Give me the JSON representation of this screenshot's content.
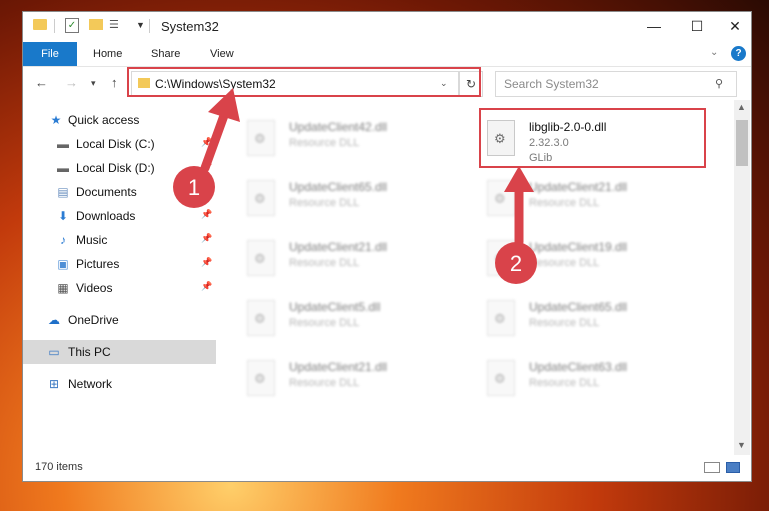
{
  "window": {
    "title": "System32",
    "controls": {
      "minimize": "—",
      "maximize": "☐",
      "close": "✕"
    }
  },
  "ribbon": {
    "tabs": [
      "File",
      "Home",
      "Share",
      "View"
    ],
    "help": "?",
    "expand": "⌄"
  },
  "navigation": {
    "back": "←",
    "forward": "→",
    "recent": "▾",
    "up": "↑",
    "address": "C:\\Windows\\System32",
    "refresh": "↻",
    "search_placeholder": "Search System32",
    "search_icon": "⚲"
  },
  "sidebar": {
    "items": [
      {
        "label": "Quick access",
        "icon": "star-icon"
      },
      {
        "label": "Local Disk (C:)",
        "icon": "drive-icon"
      },
      {
        "label": "Local Disk (D:)",
        "icon": "drive-icon"
      },
      {
        "label": "Documents",
        "icon": "documents-icon"
      },
      {
        "label": "Downloads",
        "icon": "download-icon"
      },
      {
        "label": "Music",
        "icon": "music-icon"
      },
      {
        "label": "Pictures",
        "icon": "pictures-icon"
      },
      {
        "label": "Videos",
        "icon": "videos-icon"
      },
      {
        "label": "OneDrive",
        "icon": "cloud-icon"
      },
      {
        "label": "This PC",
        "icon": "computer-icon"
      },
      {
        "label": "Network",
        "icon": "network-icon"
      }
    ]
  },
  "files": [
    {
      "name": "UpdateClient42.dll",
      "type": "Resource DLL"
    },
    {
      "name": "libglib-2.0-0.dll",
      "version": "2.32.3.0",
      "company": "GLib"
    },
    {
      "name": "UpdateClient65.dll",
      "type": "Resource DLL"
    },
    {
      "name": "UpdateClient21.dll",
      "type": "Resource DLL"
    },
    {
      "name": "UpdateClient21.dll",
      "type": "Resource DLL"
    },
    {
      "name": "UpdateClient19.dll",
      "type": "Resource DLL"
    },
    {
      "name": "UpdateClient5.dll",
      "type": "Resource DLL"
    },
    {
      "name": "UpdateClient65.dll",
      "type": "Resource DLL"
    },
    {
      "name": "UpdateClient21.dll",
      "type": "Resource DLL"
    },
    {
      "name": "UpdateClient63.dll",
      "type": "Resource DLL"
    }
  ],
  "status": {
    "count": "170 items"
  },
  "annotations": {
    "step1": "1",
    "step2": "2",
    "accent": "#d9434a"
  }
}
